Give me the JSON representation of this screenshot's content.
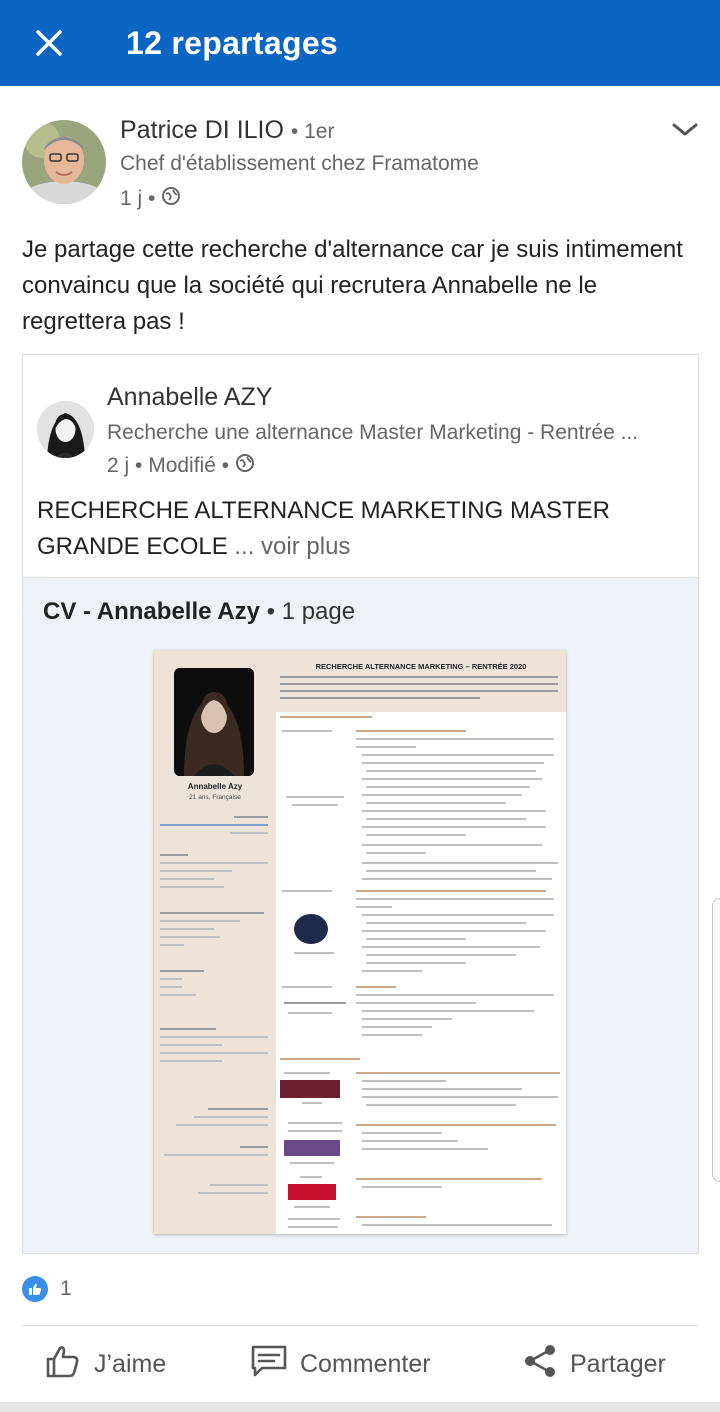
{
  "header": {
    "title": "12 repartages",
    "close_icon": "close-icon"
  },
  "post": {
    "author": {
      "name": "Patrice DI ILIO",
      "degree": "• 1er",
      "headline": "Chef d'établissement chez Framatome"
    },
    "meta": {
      "time": "1 j •",
      "visibility_icon": "globe-icon"
    },
    "text": "Je partage cette recherche d'alternance car je suis intimement convaincu que la société qui recrutera Annabelle ne le regrettera pas !",
    "shared": {
      "author_name": "Annabelle AZY",
      "headline": "Recherche une alternance Master Marketing - Rentrée ...",
      "meta": "2 j • Modifié •",
      "text": "RECHERCHE ALTERNANCE MARKETING MASTER GRANDE ECOLE",
      "see_more": " ... voir plus",
      "document": {
        "title": "CV - Annabelle Azy",
        "pages": "• 1 page",
        "preview": {
          "heading": "RECHERCHE ALTERNANCE MARKETING – RENTRÉE 2020",
          "name": "Annabelle Azy",
          "age": "21 ans, Française"
        }
      }
    },
    "reactions": {
      "count": "1",
      "icon": "like-reaction-icon"
    }
  },
  "actions": {
    "like": "J’aime",
    "comment": "Commenter",
    "share": "Partager"
  },
  "colors": {
    "brand_blue": "#0a66c2",
    "cv_beige": "#ede3d9"
  }
}
